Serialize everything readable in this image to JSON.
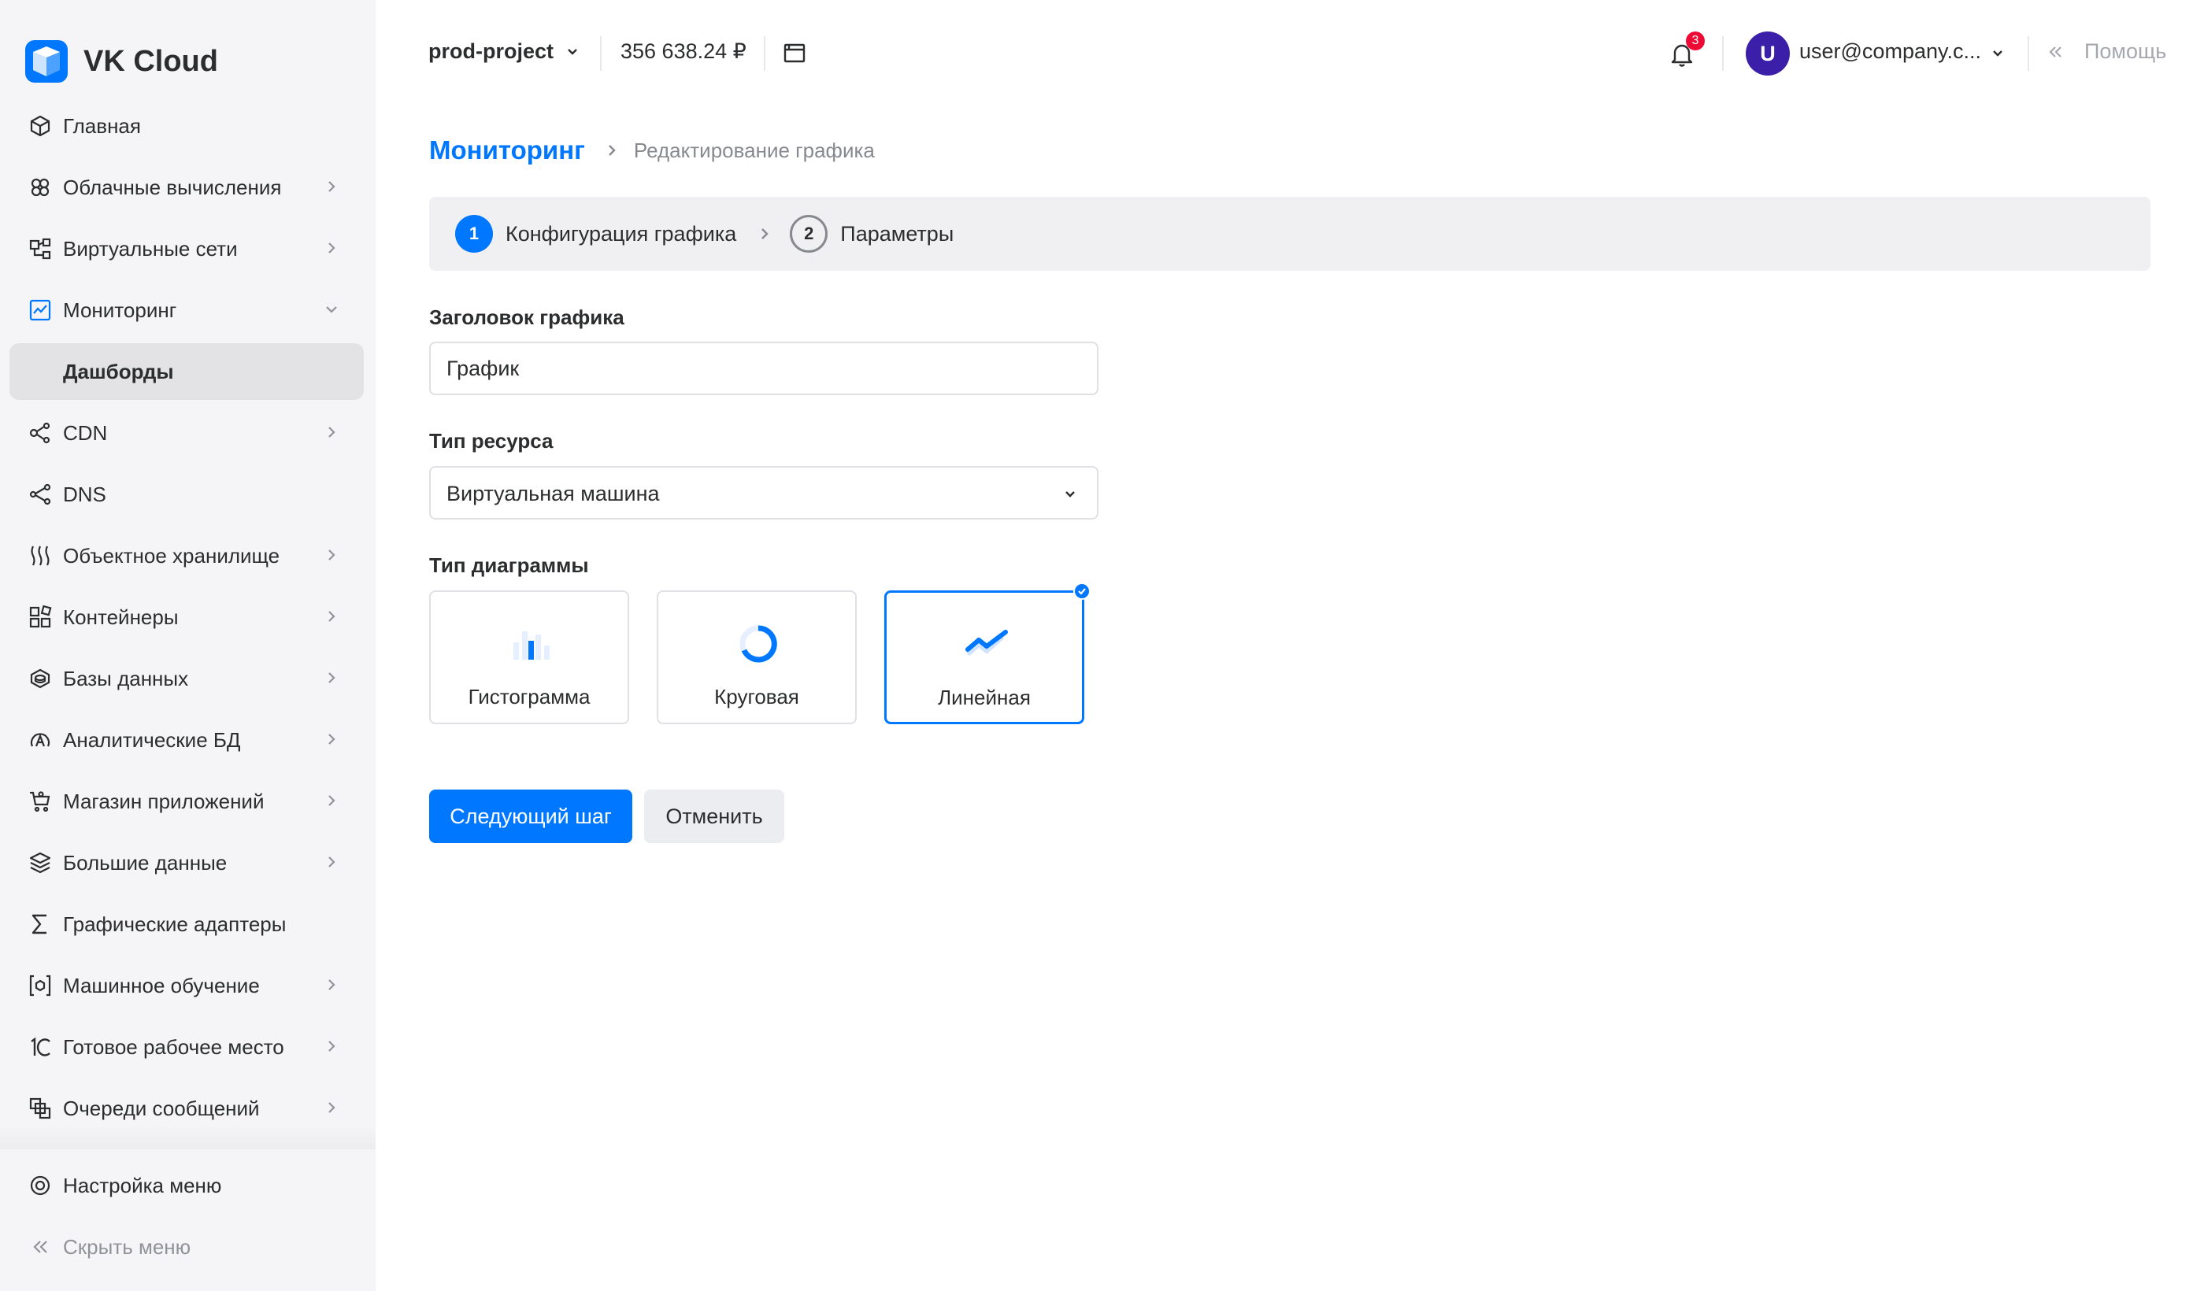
{
  "brand": {
    "name": "VK Cloud",
    "accent": "#0077ff"
  },
  "sidebar": {
    "items": [
      {
        "label": "Главная",
        "icon": "cube-icon",
        "chevron": false
      },
      {
        "label": "Облачные вычисления",
        "icon": "cloud-compute-icon",
        "chevron": true
      },
      {
        "label": "Виртуальные сети",
        "icon": "network-icon",
        "chevron": true
      },
      {
        "label": "Мониторинг",
        "icon": "monitoring-icon",
        "chevron": true,
        "expanded": true
      },
      {
        "label": "Дашборды",
        "sub": true,
        "active": true
      },
      {
        "label": "CDN",
        "icon": "cdn-icon",
        "chevron": true
      },
      {
        "label": "DNS",
        "icon": "dns-icon",
        "chevron": false
      },
      {
        "label": "Объектное хранилище",
        "icon": "object-storage-icon",
        "chevron": true
      },
      {
        "label": "Контейнеры",
        "icon": "containers-icon",
        "chevron": true
      },
      {
        "label": "Базы данных",
        "icon": "database-icon",
        "chevron": true
      },
      {
        "label": "Аналитические БД",
        "icon": "analytics-db-icon",
        "chevron": true
      },
      {
        "label": "Магазин приложений",
        "icon": "cart-icon",
        "chevron": true
      },
      {
        "label": "Большие данные",
        "icon": "layers-icon",
        "chevron": true
      },
      {
        "label": "Графические адаптеры",
        "icon": "sigma-icon",
        "chevron": false
      },
      {
        "label": "Машинное обучение",
        "icon": "ml-icon",
        "chevron": true
      },
      {
        "label": "Готовое рабочее место",
        "icon": "1c-icon",
        "chevron": true
      },
      {
        "label": "Очереди сообщений",
        "icon": "queue-icon",
        "chevron": true
      }
    ],
    "settings_label": "Настройка меню",
    "hide_label": "Скрыть меню"
  },
  "header": {
    "project": "prod-project",
    "balance": "356 638.24 ₽",
    "notifications_count": "3",
    "avatar_letter": "U",
    "user_email": "user@company.c...",
    "help_label": "Помощь"
  },
  "breadcrumb": {
    "root": "Мониторинг",
    "current": "Редактирование графика"
  },
  "steps": [
    {
      "num": "1",
      "label": "Конфигурация графика",
      "active": true
    },
    {
      "num": "2",
      "label": "Параметры",
      "active": false
    }
  ],
  "form": {
    "title_label": "Заголовок графика",
    "title_value": "График",
    "resource_label": "Тип ресурса",
    "resource_value": "Виртуальная машина",
    "chart_type_label": "Тип диаграммы",
    "chart_types": [
      {
        "label": "Гистограмма",
        "icon": "histogram-icon",
        "selected": false
      },
      {
        "label": "Круговая",
        "icon": "donut-icon",
        "selected": false
      },
      {
        "label": "Линейная",
        "icon": "line-chart-icon",
        "selected": true
      }
    ]
  },
  "actions": {
    "next_label": "Следующий шаг",
    "cancel_label": "Отменить"
  }
}
